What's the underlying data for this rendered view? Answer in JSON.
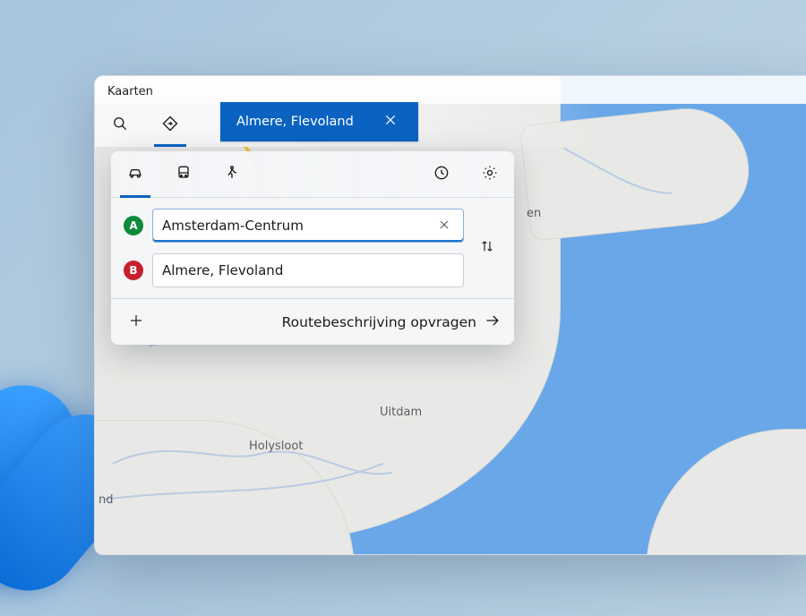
{
  "window": {
    "title": "Kaarten"
  },
  "toolbar": {
    "tabs": [
      "search",
      "directions"
    ],
    "active_tab": "directions"
  },
  "active_pill": {
    "label": "Almere, Flevoland"
  },
  "directions": {
    "modes": [
      "car",
      "transit",
      "walk"
    ],
    "active_mode": "car",
    "origin": {
      "letter": "A",
      "color": "#0d8a3b",
      "value": "Amsterdam-Centrum"
    },
    "destination": {
      "letter": "B",
      "color": "#c7202c",
      "value": "Almere, Flevoland"
    },
    "add_stop_icon": "plus",
    "swap_icon": "swap-vertical",
    "history_icon": "clock",
    "settings_icon": "gear",
    "cta": "Routebeschrijving opvragen"
  },
  "map_labels": {
    "marken_area": "en",
    "uitdam": "Uitdam",
    "holysloot": "Holysloot",
    "nd": "nd"
  }
}
